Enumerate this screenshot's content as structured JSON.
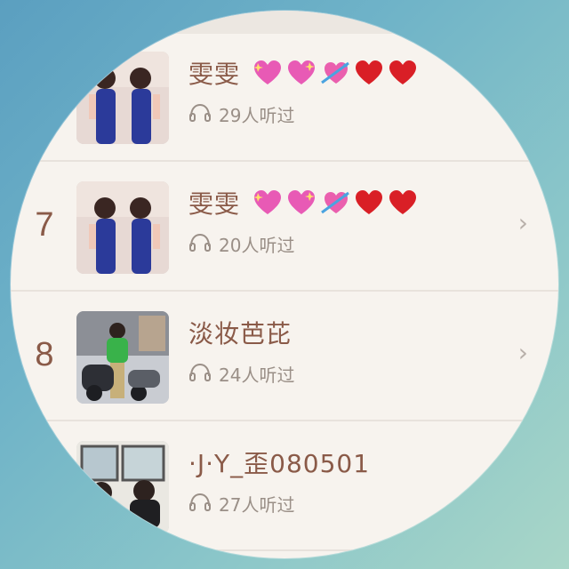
{
  "rows": [
    {
      "rank": "",
      "name": "雯雯",
      "emoji": [
        "sparkling-heart",
        "sparkling-heart",
        "heart-with-arrow",
        "red-heart",
        "red-heart"
      ],
      "listens": "29人听过",
      "has_chevron": false,
      "thumb": "two-women-blue-dresses"
    },
    {
      "rank": "7",
      "name": "雯雯",
      "emoji": [
        "sparkling-heart",
        "sparkling-heart",
        "heart-with-arrow",
        "red-heart",
        "red-heart"
      ],
      "listens": "20人听过",
      "has_chevron": true,
      "thumb": "two-women-blue-dresses"
    },
    {
      "rank": "8",
      "name": "淡妆芭芘",
      "emoji": [],
      "listens": "24人听过",
      "has_chevron": true,
      "thumb": "woman-scooter-green"
    },
    {
      "rank": "",
      "name": "·J·Y_歪080501",
      "emoji": [],
      "listens": "27人听过",
      "has_chevron": false,
      "thumb": "two-people-window"
    }
  ],
  "colors": {
    "accent_text": "#8a5a48",
    "secondary_text": "#9a8f87",
    "card_bg": "#f7f3ee"
  }
}
